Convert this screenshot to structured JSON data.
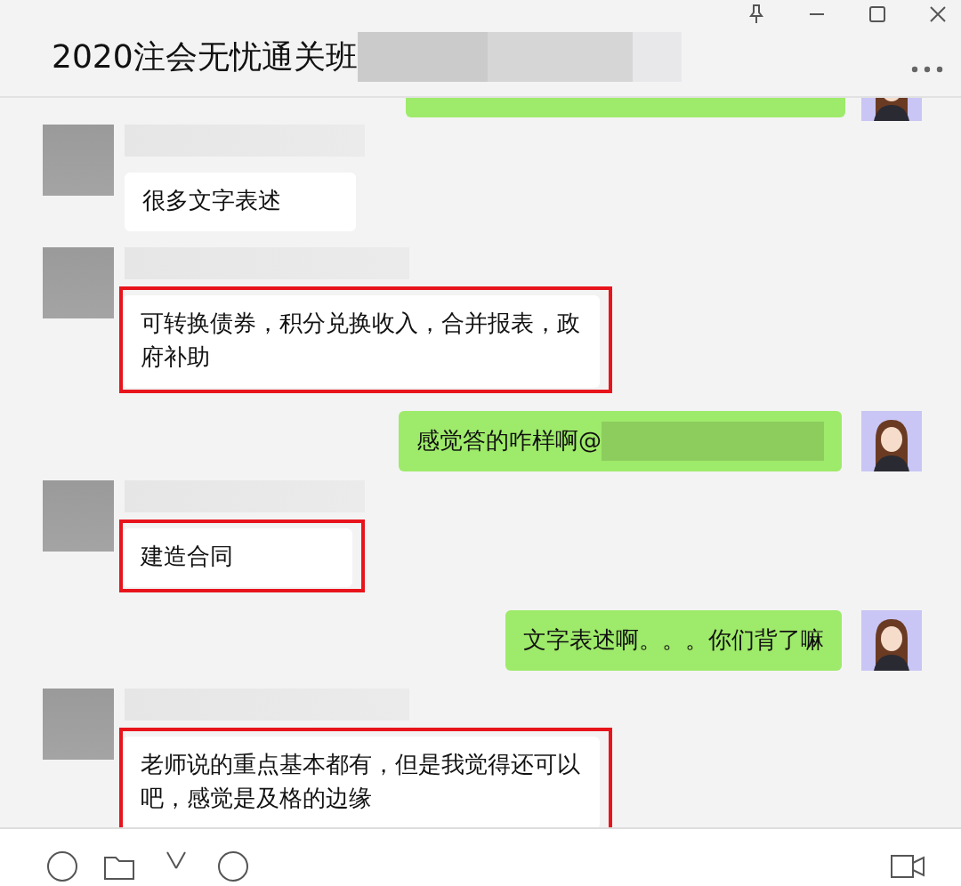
{
  "window": {
    "title": "2020注会无忧通关班"
  },
  "messages": [
    {
      "kind": "received",
      "text": "很多文字表述",
      "highlighted": false
    },
    {
      "kind": "received",
      "text": "可转换债券，积分兑换收入，合并报表，政府补助",
      "highlighted": true
    },
    {
      "kind": "sent",
      "text": "感觉答的咋样啊@"
    },
    {
      "kind": "received",
      "text": "建造合同",
      "highlighted": true
    },
    {
      "kind": "sent",
      "text": "文字表述啊。。。你们背了嘛"
    },
    {
      "kind": "received",
      "text": "老师说的重点基本都有，但是我觉得还可以吧，感觉是及格的边缘",
      "highlighted": true
    }
  ]
}
